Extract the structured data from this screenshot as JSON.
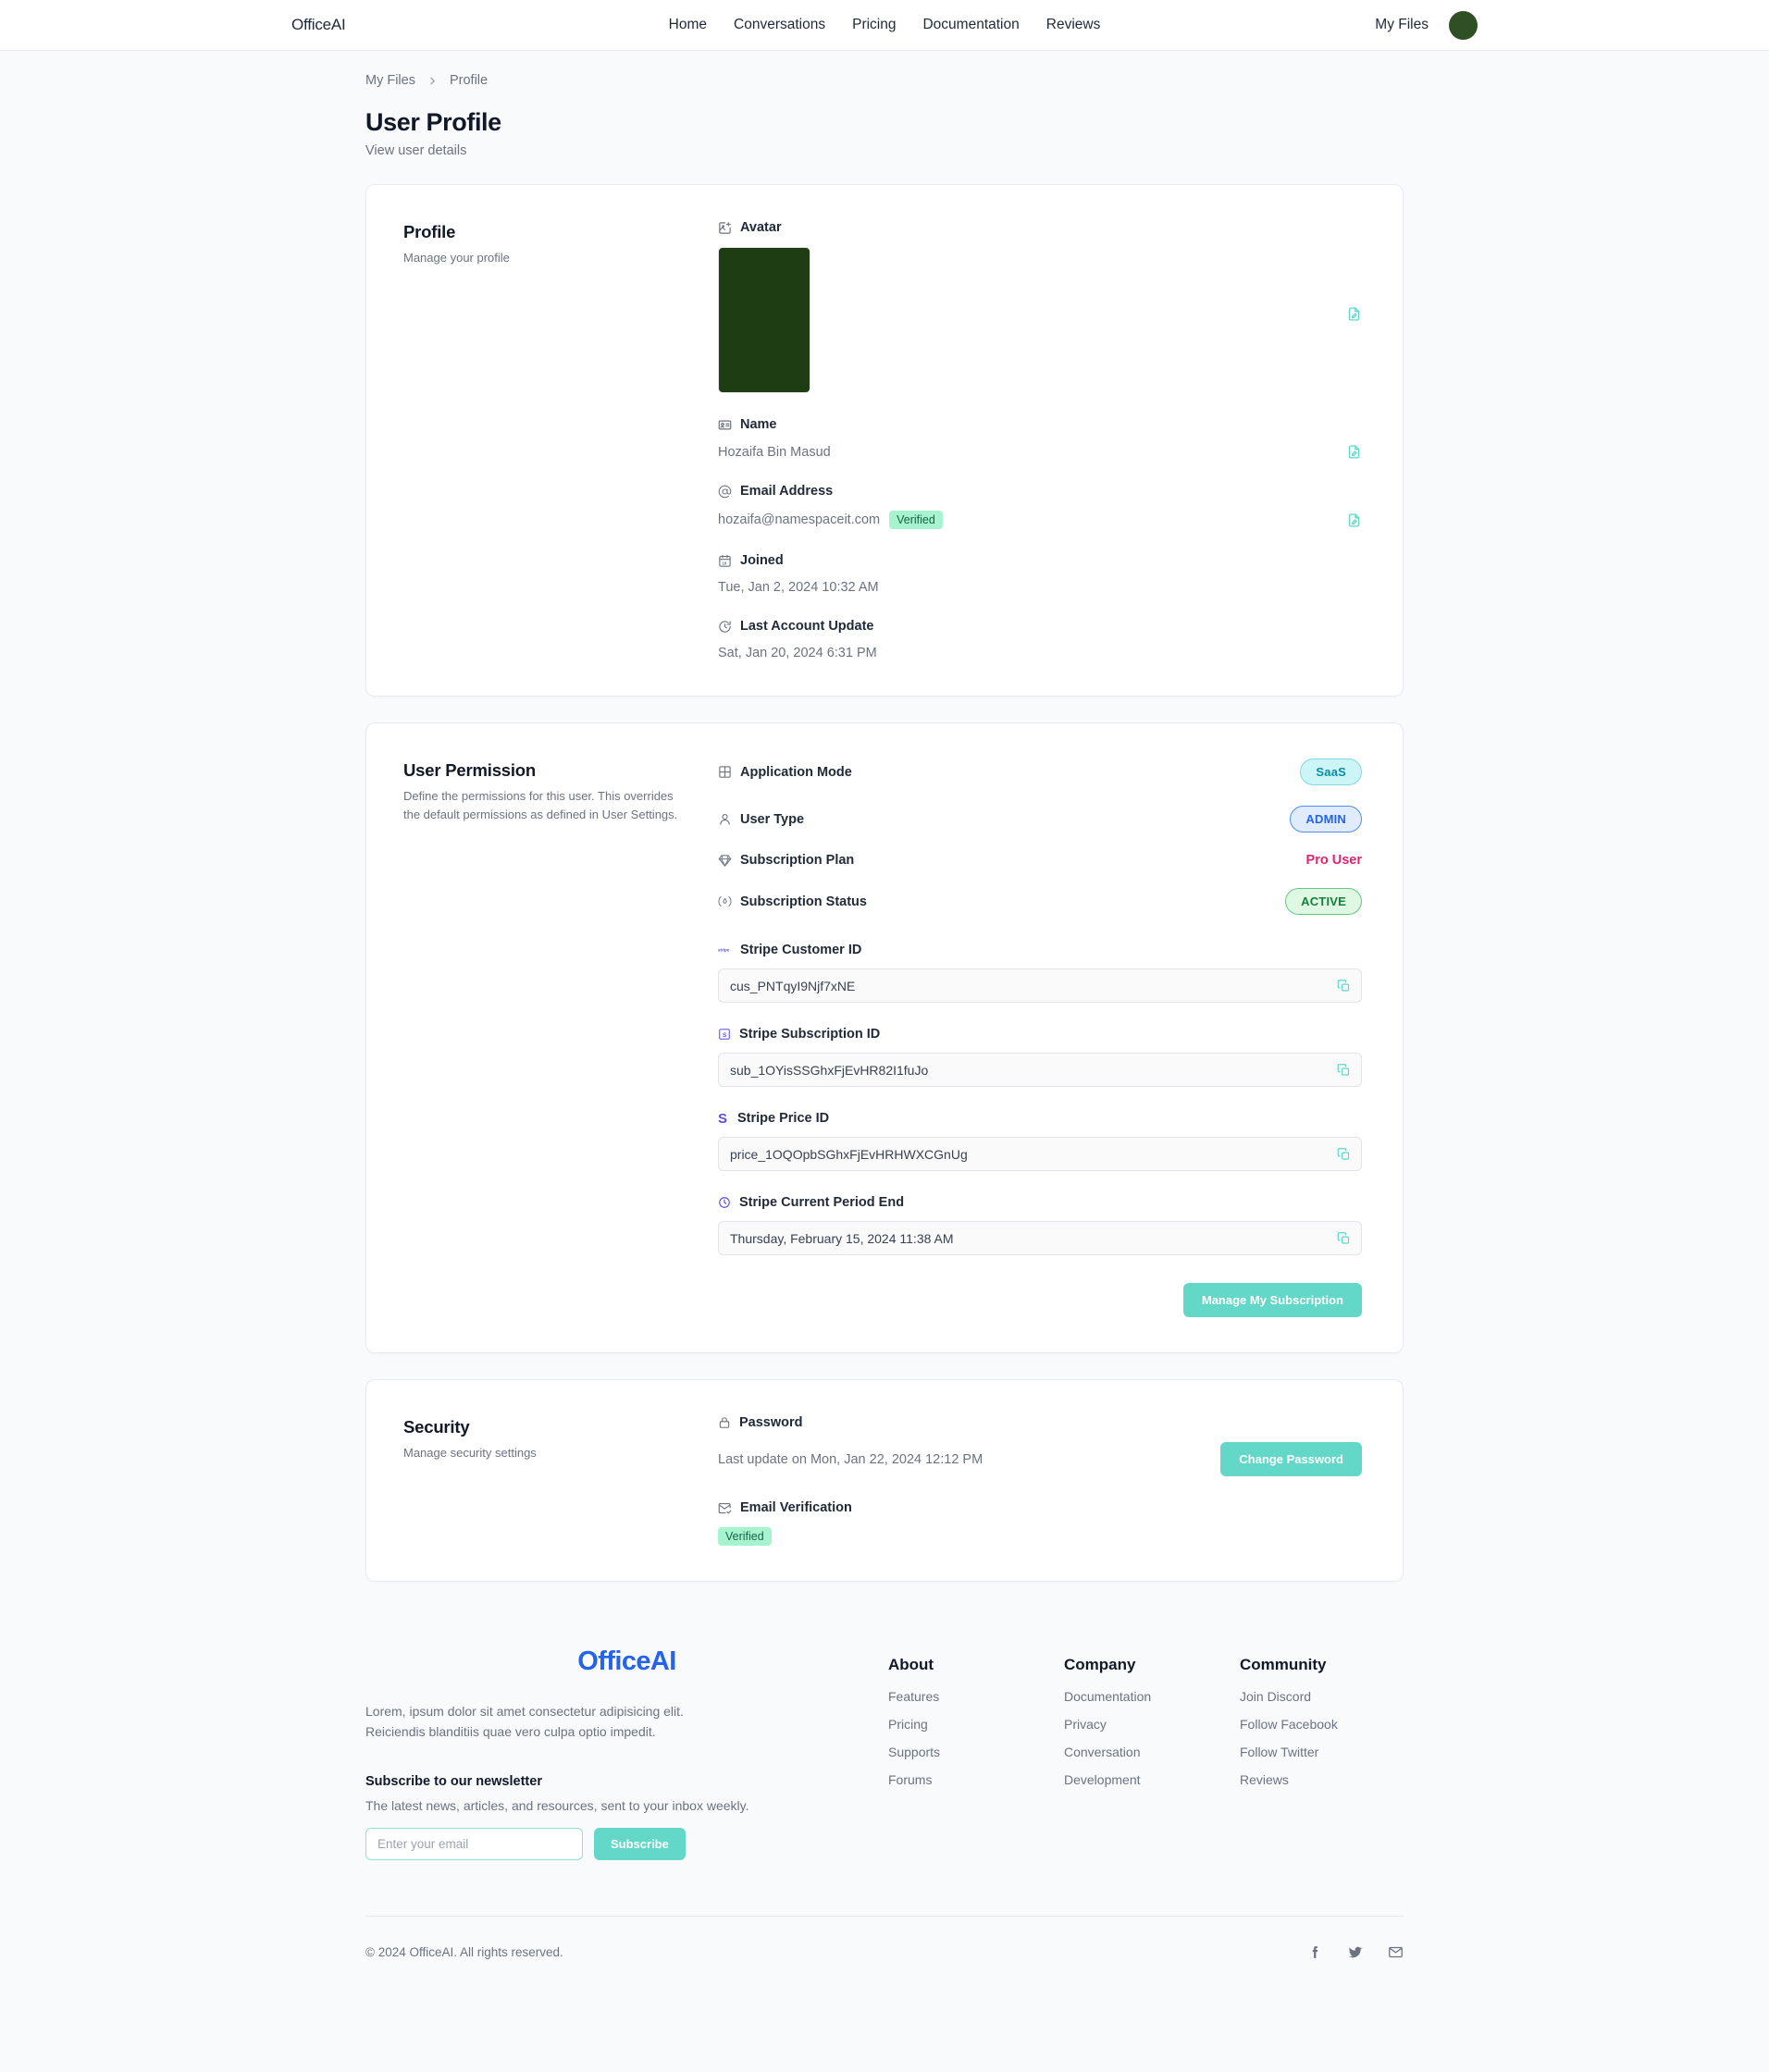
{
  "navbar": {
    "brand": "OfficeAI",
    "links": [
      {
        "label": "Home"
      },
      {
        "label": "Conversations"
      },
      {
        "label": "Pricing"
      },
      {
        "label": "Documentation"
      },
      {
        "label": "Reviews"
      }
    ],
    "my_files": "My Files"
  },
  "breadcrumb": {
    "root": "My Files",
    "current": "Profile"
  },
  "header": {
    "title": "User Profile",
    "subtitle": "View user details"
  },
  "profile_card": {
    "title": "Profile",
    "desc": "Manage your profile",
    "avatar_label": "Avatar",
    "name_label": "Name",
    "name_value": "Hozaifa Bin Masud",
    "email_label": "Email Address",
    "email_value": "hozaifa@namespaceit.com",
    "email_badge": "Verified",
    "joined_label": "Joined",
    "joined_value": "Tue, Jan 2, 2024 10:32 AM",
    "last_update_label": "Last Account Update",
    "last_update_value": "Sat, Jan 20, 2024 6:31 PM"
  },
  "permission_card": {
    "title": "User Permission",
    "desc": "Define the permissions for this user. This overrides the default permissions as defined in User Settings.",
    "app_mode_label": "Application Mode",
    "app_mode_value": "SaaS",
    "user_type_label": "User Type",
    "user_type_value": "ADMIN",
    "plan_label": "Subscription Plan",
    "plan_value": "Pro User",
    "status_label": "Subscription Status",
    "status_value": "ACTIVE",
    "customer_id_label": "Stripe Customer ID",
    "customer_id_value": "cus_PNTqyI9Njf7xNE",
    "subscription_id_label": "Stripe Subscription ID",
    "subscription_id_value": "sub_1OYisSSGhxFjEvHR82I1fuJo",
    "price_id_label": "Stripe Price ID",
    "price_id_value": "price_1OQOpbSGhxFjEvHRHWXCGnUg",
    "period_end_label": "Stripe Current Period End",
    "period_end_value": "Thursday, February 15, 2024 11:38 AM",
    "manage_button": "Manage My Subscription"
  },
  "security_card": {
    "title": "Security",
    "desc": "Manage security settings",
    "password_label": "Password",
    "password_value": "Last update on Mon, Jan 22, 2024 12:12 PM",
    "change_password_button": "Change Password",
    "email_verification_label": "Email Verification",
    "email_verification_badge": "Verified"
  },
  "footer": {
    "logo": "OfficeAI",
    "lorem": "Lorem, ipsum dolor sit amet consectetur adipisicing elit. Reiciendis blanditiis quae vero culpa optio impedit.",
    "newsletter_title": "Subscribe to our newsletter",
    "newsletter_sub": "The latest news, articles, and resources, sent to your inbox weekly.",
    "email_placeholder": "Enter your email",
    "subscribe_button": "Subscribe",
    "columns": [
      {
        "head": "About",
        "links": [
          {
            "label": "Features"
          },
          {
            "label": "Pricing"
          },
          {
            "label": "Supports"
          },
          {
            "label": "Forums"
          }
        ]
      },
      {
        "head": "Company",
        "links": [
          {
            "label": "Documentation"
          },
          {
            "label": "Privacy"
          },
          {
            "label": "Conversation"
          },
          {
            "label": "Development"
          }
        ]
      },
      {
        "head": "Community",
        "links": [
          {
            "label": "Join Discord"
          },
          {
            "label": "Follow Facebook"
          },
          {
            "label": "Follow Twitter"
          },
          {
            "label": "Reviews"
          }
        ]
      }
    ],
    "copyright": "© 2024 OfficeAI. All rights reserved."
  },
  "colors": {
    "accent_teal": "#63d7c8",
    "brand_blue": "#2563eb",
    "plan_pink": "#e0246f",
    "saas_cyan": "#0d8ba1",
    "admin_blue": "#2563eb",
    "active_green": "#15803d",
    "verified_green": "#14663f"
  }
}
